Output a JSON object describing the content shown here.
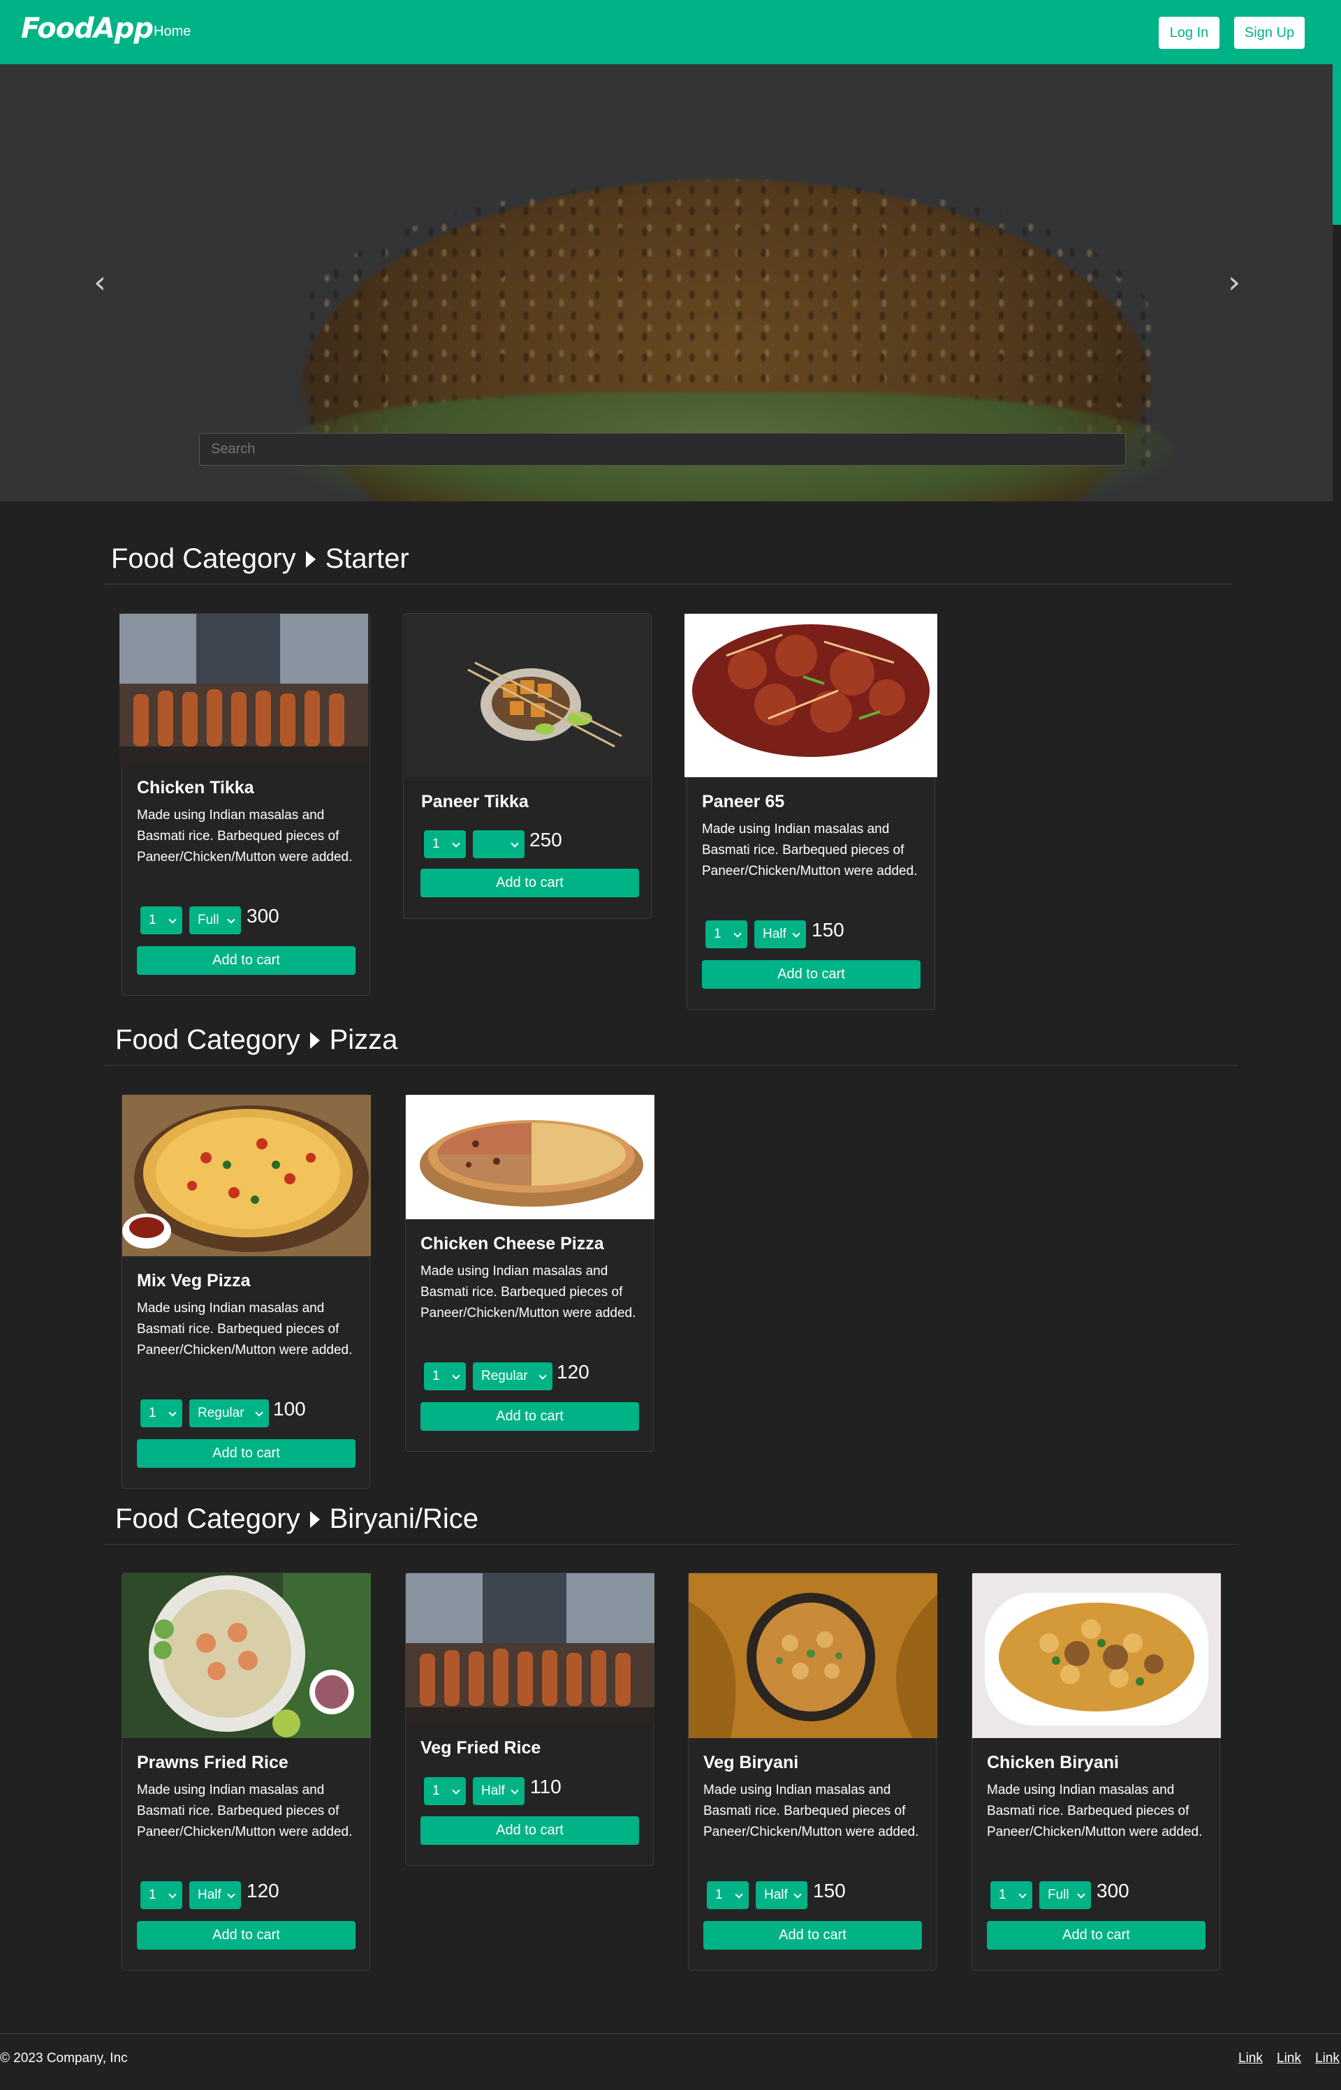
{
  "nav": {
    "brand": "FoodApp",
    "home": "Home",
    "login": "Log In",
    "signup": "Sign Up"
  },
  "hero": {
    "search_placeholder": "Search",
    "prev_icon": "chevron-left-icon",
    "next_icon": "chevron-right-icon"
  },
  "categories": [
    {
      "label": "Food Category",
      "name": "Starter"
    },
    {
      "label": "Food Category",
      "name": "Pizza"
    },
    {
      "label": "Food Category",
      "name": "Biryani/Rice"
    }
  ],
  "items": {
    "chicken_tikka": {
      "name": "Chicken Tikka",
      "desc": "Made using Indian masalas and Basmati rice. Barbequed pieces of Paneer/Chicken/Mutton were added.",
      "qty": "1",
      "size": "Full",
      "price": "300",
      "cart": "Add to cart"
    },
    "paneer_tikka": {
      "name": "Paneer Tikka",
      "qty": "1",
      "size": "",
      "price": "250",
      "cart": "Add to cart"
    },
    "paneer_65": {
      "name": "Paneer 65",
      "desc": "Made using Indian masalas and Basmati rice. Barbequed pieces of Paneer/Chicken/Mutton were added.",
      "qty": "1",
      "size": "Half",
      "price": "150",
      "cart": "Add to cart"
    },
    "mix_veg_pizza": {
      "name": "Mix Veg Pizza",
      "desc": "Made using Indian masalas and Basmati rice. Barbequed pieces of Paneer/Chicken/Mutton were added.",
      "qty": "1",
      "size": "Regular",
      "price": "100",
      "cart": "Add to cart"
    },
    "chicken_cheese_pizza": {
      "name": "Chicken Cheese Pizza",
      "desc": "Made using Indian masalas and Basmati rice. Barbequed pieces of Paneer/Chicken/Mutton were added.",
      "qty": "1",
      "size": "Regular",
      "price": "120",
      "cart": "Add to cart"
    },
    "prawns_fried_rice": {
      "name": "Prawns Fried Rice",
      "desc": "Made using Indian masalas and Basmati rice. Barbequed pieces of Paneer/Chicken/Mutton were added.",
      "qty": "1",
      "size": "Half",
      "price": "120",
      "cart": "Add to cart"
    },
    "veg_fried_rice": {
      "name": "Veg Fried Rice",
      "qty": "1",
      "size": "Half",
      "price": "110",
      "cart": "Add to cart"
    },
    "veg_biryani": {
      "name": "Veg Biryani",
      "desc": "Made using Indian masalas and Basmati rice. Barbequed pieces of Paneer/Chicken/Mutton were added.",
      "qty": "1",
      "size": "Half",
      "price": "150",
      "cart": "Add to cart"
    },
    "chicken_biryani": {
      "name": "Chicken Biryani",
      "desc": "Made using Indian masalas and Basmati rice. Barbequed pieces of Paneer/Chicken/Mutton were added.",
      "qty": "1",
      "size": "Full",
      "price": "300",
      "cart": "Add to cart"
    }
  },
  "footer": {
    "copyright": "© 2023 Company, Inc",
    "links": [
      "Link",
      "Link",
      "Link"
    ]
  },
  "colors": {
    "accent": "#00b386",
    "background": "#212121"
  }
}
